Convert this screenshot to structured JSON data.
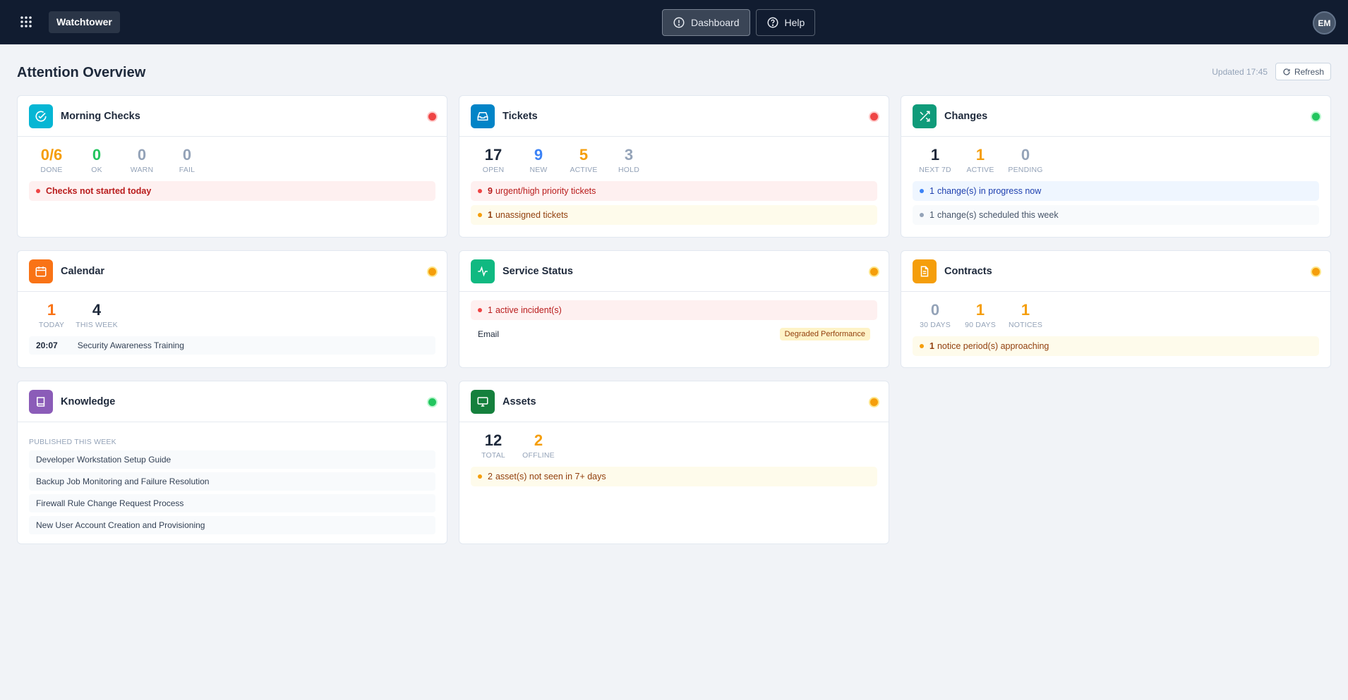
{
  "header": {
    "app_title": "Watchtower",
    "nav": [
      {
        "label": "Dashboard",
        "icon": "alert-circle-icon",
        "active": true
      },
      {
        "label": "Help",
        "icon": "help-circle-icon",
        "active": false
      }
    ],
    "avatar": "EM"
  },
  "page": {
    "title": "Attention Overview",
    "updated": "Updated 17:45",
    "refresh_label": "Refresh"
  },
  "cards": {
    "morning": {
      "title": "Morning Checks",
      "status": "red",
      "accent": "#06b6d4",
      "stats": [
        {
          "num": "0/6",
          "label": "DONE"
        },
        {
          "num": "0",
          "label": "OK"
        },
        {
          "num": "0",
          "label": "WARN"
        },
        {
          "num": "0",
          "label": "FAIL"
        }
      ],
      "alert": "Checks not started today"
    },
    "tickets": {
      "title": "Tickets",
      "status": "red",
      "accent": "#0284c7",
      "stats": [
        {
          "num": "17",
          "label": "OPEN"
        },
        {
          "num": "9",
          "label": "NEW"
        },
        {
          "num": "5",
          "label": "ACTIVE"
        },
        {
          "num": "3",
          "label": "HOLD"
        }
      ],
      "alerts": [
        {
          "count": "9",
          "text": "urgent/high priority tickets"
        },
        {
          "count": "1",
          "text": "unassigned tickets"
        }
      ]
    },
    "changes": {
      "title": "Changes",
      "status": "green",
      "accent": "#0f9b7a",
      "stats": [
        {
          "num": "1",
          "label": "NEXT 7D"
        },
        {
          "num": "1",
          "label": "ACTIVE"
        },
        {
          "num": "0",
          "label": "PENDING"
        }
      ],
      "alerts": [
        {
          "count": "1",
          "text": "change(s) in progress now"
        },
        {
          "count": "1",
          "text": "change(s) scheduled this week"
        }
      ]
    },
    "calendar": {
      "title": "Calendar",
      "status": "orange",
      "accent": "#f97316",
      "stats": [
        {
          "num": "1",
          "label": "TODAY"
        },
        {
          "num": "4",
          "label": "THIS WEEK"
        }
      ],
      "events": [
        {
          "time": "20:07",
          "title": "Security Awareness Training"
        }
      ]
    },
    "service": {
      "title": "Service Status",
      "status": "orange",
      "accent": "#10b981",
      "alert": {
        "count": "1",
        "text": "active incident(s)"
      },
      "services": [
        {
          "name": "Email",
          "state": "Degraded Performance"
        }
      ]
    },
    "contracts": {
      "title": "Contracts",
      "status": "orange",
      "accent": "#f59e0b",
      "stats": [
        {
          "num": "0",
          "label": "30 DAYS"
        },
        {
          "num": "1",
          "label": "90 DAYS"
        },
        {
          "num": "1",
          "label": "NOTICES"
        }
      ],
      "alert": {
        "count": "1",
        "text": "notice period(s) approaching"
      }
    },
    "knowledge": {
      "title": "Knowledge",
      "status": "green",
      "accent": "#8b5cb8",
      "section_label": "PUBLISHED THIS WEEK",
      "articles": [
        "Developer Workstation Setup Guide",
        "Backup Job Monitoring and Failure Resolution",
        "Firewall Rule Change Request Process",
        "New User Account Creation and Provisioning"
      ]
    },
    "assets": {
      "title": "Assets",
      "status": "orange",
      "accent": "#15803d",
      "stats": [
        {
          "num": "12",
          "label": "TOTAL"
        },
        {
          "num": "2",
          "label": "OFFLINE"
        }
      ],
      "alert": {
        "count": "2",
        "text": "asset(s) not seen in 7+ days"
      }
    }
  }
}
